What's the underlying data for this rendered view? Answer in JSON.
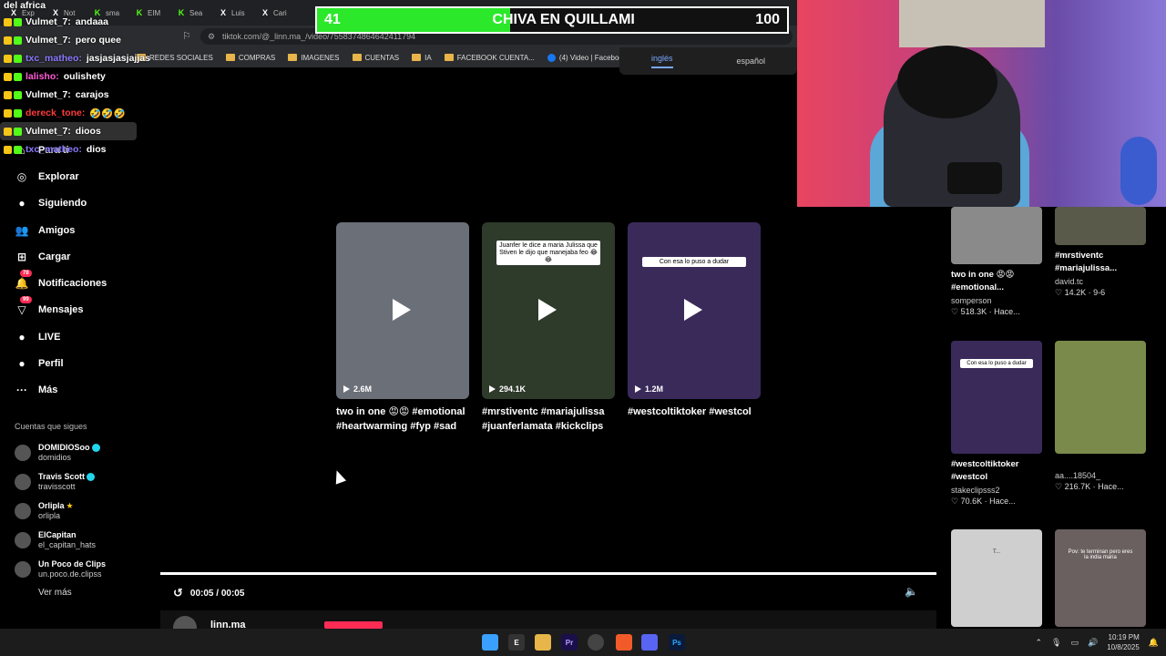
{
  "browser": {
    "tabs": [
      {
        "icon": "X",
        "label": "Exp",
        "color": "#ffffff"
      },
      {
        "icon": "X",
        "label": "Not",
        "color": "#ffffff"
      },
      {
        "icon": "K",
        "label": "sma",
        "color": "#53fc18"
      },
      {
        "icon": "K",
        "label": "EIM",
        "color": "#53fc18"
      },
      {
        "icon": "K",
        "label": "Sea",
        "color": "#53fc18"
      },
      {
        "icon": "X",
        "label": "Luis",
        "color": "#ffffff"
      },
      {
        "icon": "X",
        "label": "Cari",
        "color": "#ffffff"
      }
    ],
    "url": "tiktok.com/@_linn.ma_/video/7558374864642411794",
    "bookmarks": [
      {
        "label": "REDES SOCIALES",
        "type": "folder"
      },
      {
        "label": "COMPRAS",
        "type": "folder"
      },
      {
        "label": "IMAGENES",
        "type": "folder"
      },
      {
        "label": "CUENTAS",
        "type": "folder"
      },
      {
        "label": "IA",
        "type": "folder"
      },
      {
        "label": "FACEBOOK CUENTA...",
        "type": "folder"
      },
      {
        "label": "(4) Video | Facebook",
        "type": "facebook"
      }
    ],
    "translate_popup": {
      "lang1": "inglés",
      "lang2": "español"
    }
  },
  "chat": {
    "title": "del africa",
    "messages": [
      {
        "user": "Vulmet_7:",
        "text": "andaaa",
        "color": "#ffffff",
        "highlight": false
      },
      {
        "user": "Vulmet_7:",
        "text": "pero quee",
        "color": "#ffffff",
        "highlight": false
      },
      {
        "user": "txc_matheo:",
        "text": "jasjasjasjajjas",
        "color": "#8a7bff",
        "highlight": false
      },
      {
        "user": "lalisho:",
        "text": "oulishety",
        "color": "#ff5cd6",
        "highlight": false
      },
      {
        "user": "Vulmet_7:",
        "text": "carajos",
        "color": "#ffffff",
        "highlight": false
      },
      {
        "user": "dereck_tone:",
        "text": "🤣🤣🤣",
        "color": "#ff3b3b",
        "highlight": false
      },
      {
        "user": "Vulmet_7:",
        "text": "dioos",
        "color": "#ffffff",
        "highlight": true
      },
      {
        "user": "txc_matheo:",
        "text": "dios",
        "color": "#8a7bff",
        "highlight": false
      }
    ]
  },
  "score": {
    "left": "41",
    "center": "CHIVA EN QUILLAMI",
    "right": "100",
    "progress": 0.41,
    "fill_color": "#2be82b"
  },
  "sidebar": {
    "nav": [
      {
        "label": "Para ti",
        "icon": "home-icon",
        "glyph": "⌂"
      },
      {
        "label": "Explorar",
        "icon": "compass-icon",
        "glyph": "◎"
      },
      {
        "label": "Siguiendo",
        "icon": "following-icon",
        "glyph": "●"
      },
      {
        "label": "Amigos",
        "icon": "friends-icon",
        "glyph": "👥"
      },
      {
        "label": "Cargar",
        "icon": "upload-icon",
        "glyph": "⊞"
      },
      {
        "label": "Notificaciones",
        "icon": "bell-icon",
        "glyph": "🔔",
        "badge": "78"
      },
      {
        "label": "Mensajes",
        "icon": "messages-icon",
        "glyph": "▽",
        "badge": "99"
      },
      {
        "label": "LIVE",
        "icon": "live-icon",
        "glyph": "●"
      },
      {
        "label": "Perfil",
        "icon": "profile-icon",
        "glyph": "●"
      },
      {
        "label": "Más",
        "icon": "more-icon",
        "glyph": "···"
      }
    ],
    "following_title": "Cuentas que sigues",
    "following": [
      {
        "name": "DOMIDIOSoo",
        "handle": "domidios",
        "mark": "verified"
      },
      {
        "name": "Travis Scott",
        "handle": "travisscott",
        "mark": "verified"
      },
      {
        "name": "Orlipla",
        "handle": "orlipla",
        "mark": "star"
      },
      {
        "name": "ElCapitan",
        "handle": "el_capitan_hats",
        "mark": ""
      },
      {
        "name": "Un Poco de Clips",
        "handle": "un.poco.de.clipss",
        "mark": ""
      }
    ],
    "see_more": "Ver más"
  },
  "videos": [
    {
      "views": "2.6M",
      "caption": "two in one 😡😡 #emotional #heartwarming #fyp #sad",
      "bg": "#6b6f78",
      "overlay": ""
    },
    {
      "views": "294.1K",
      "caption": "#mrstiventc #mariajulissa #juanferlamata #kickclips",
      "bg": "#2e3a2a",
      "overlay": "Juanfer le dice a maria Julissa que Stiven le dijo que manejaba feo 😂😂"
    },
    {
      "views": "1.2M",
      "caption": "#westcoltiktoker #westcol",
      "bg": "#3a2a5a",
      "overlay": "Con esa lo puso a dudar"
    }
  ],
  "player": {
    "time": "00:05 / 00:05",
    "author": "linn.ma"
  },
  "right_column": [
    {
      "caption": "two in one 😡😡 #emotional...",
      "author": "somperson",
      "likes": "518.3K",
      "date": "Hace...",
      "bg": "#8a8a8a"
    },
    {
      "caption": "#mrstiventc #mariajulissa...",
      "author": "david.tc",
      "likes": "14.2K",
      "date": "9-6",
      "bg": "#5a5a4a"
    },
    {
      "caption": "#westcoltiktoker #westcol",
      "author": "stakeclipsss2",
      "likes": "70.6K",
      "date": "Hace...",
      "bg": "#3a2a5a",
      "overlay": "Con esa lo puso a dudar"
    },
    {
      "caption": "",
      "author": "aa....18504_",
      "likes": "216.7K",
      "date": "Hace...",
      "bg": "#7a8a4a"
    },
    {
      "caption": "",
      "author": "",
      "likes": "",
      "date": "",
      "bg": "#cfcfcf",
      "overlay": "T..."
    },
    {
      "caption": "",
      "author": "",
      "likes": "",
      "date": "",
      "bg": "#6a6060",
      "overlay": "Pov: te terminan pero eres la india maria"
    }
  ],
  "taskbar": {
    "time": "10:19 PM",
    "date": "10/8/2025"
  }
}
